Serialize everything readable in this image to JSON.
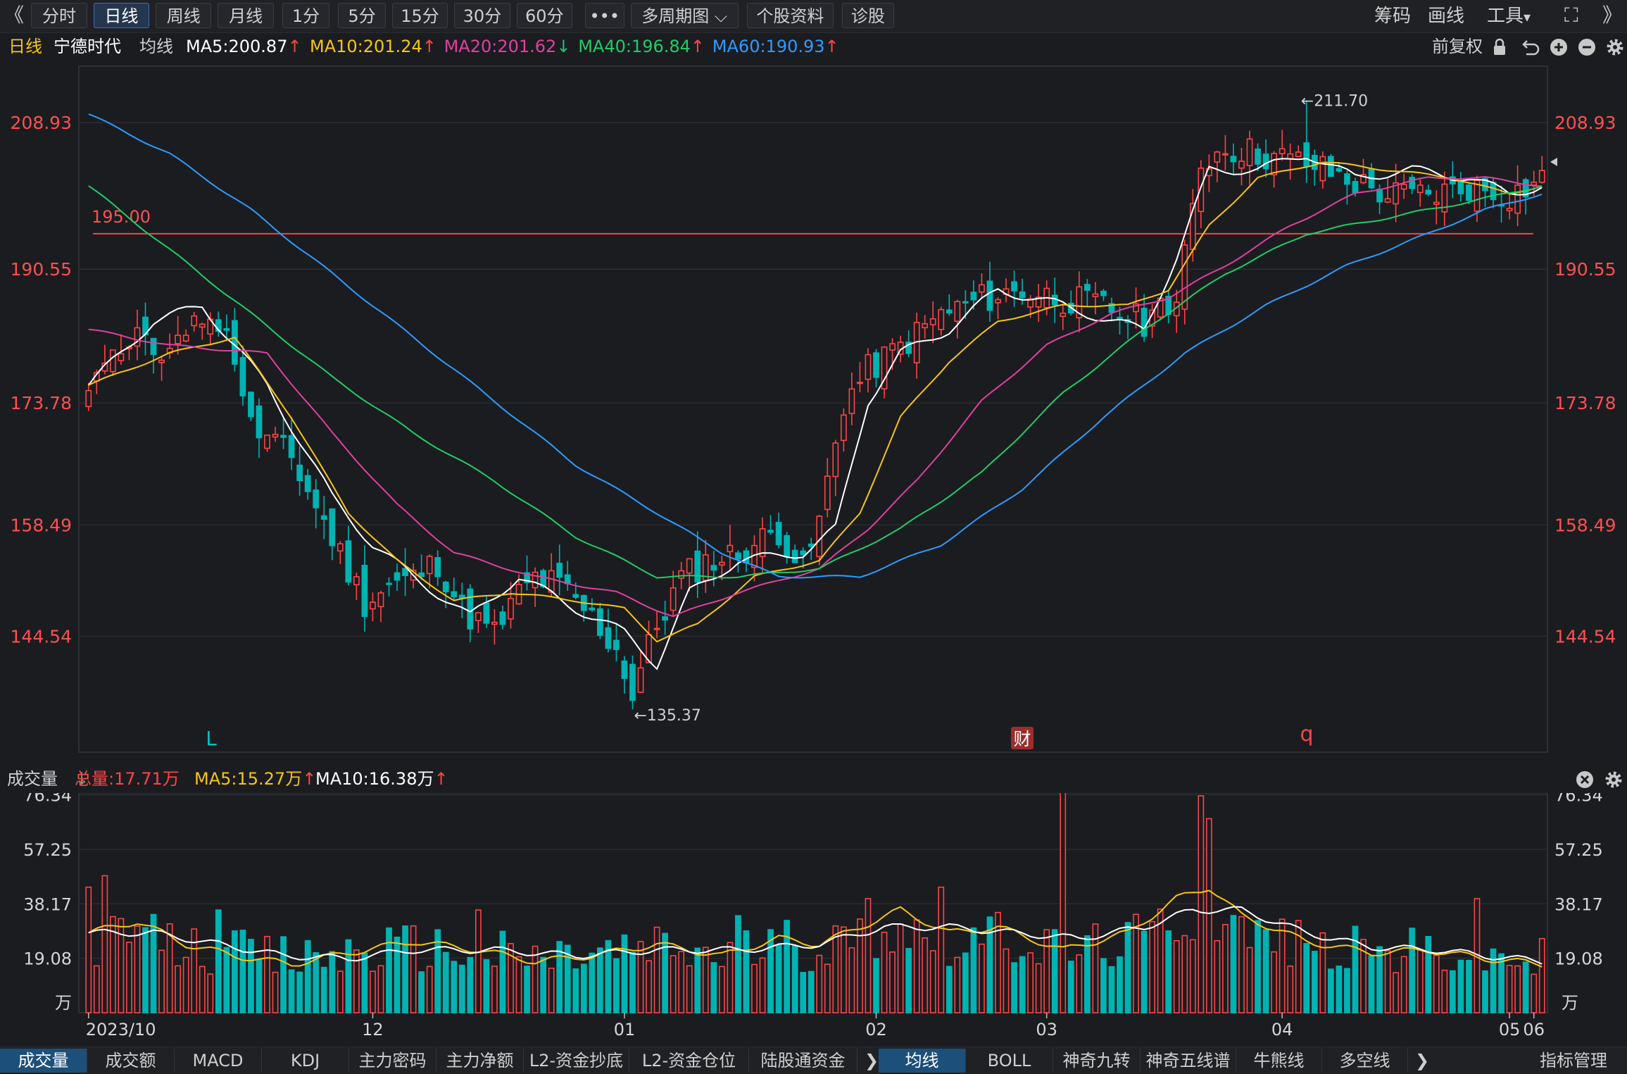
{
  "toolbar": {
    "back": "《",
    "buttons": [
      "分时",
      "日线",
      "周线",
      "月线",
      "1分",
      "5分",
      "15分",
      "30分",
      "60分",
      "•••",
      "多周期图 ⌵",
      "个股资料",
      "诊股"
    ],
    "right": [
      "筹码",
      "画线",
      "工具"
    ],
    "tool_caret": "▾",
    "expand": "⛶",
    "forward": "》"
  },
  "header": {
    "period": "日线",
    "stock_name": "宁德时代",
    "ma_label": "均线",
    "ma": [
      {
        "text": "MA5:200.87",
        "arrow": "↑",
        "color": "#ffffff"
      },
      {
        "text": "MA10:201.24",
        "arrow": "↑",
        "color": "#f5c518"
      },
      {
        "text": "MA20:201.62",
        "arrow": "↓",
        "color": "#e040a0"
      },
      {
        "text": "MA40:196.84",
        "arrow": "↑",
        "color": "#22cc66"
      },
      {
        "text": "MA60:190.93",
        "arrow": "↑",
        "color": "#2f9bff"
      }
    ],
    "adjust": "前复权",
    "icons": [
      "lock-icon",
      "undo-icon",
      "zoom-in-icon",
      "zoom-out-icon",
      "gear-icon"
    ]
  },
  "volume_header": {
    "label": "成交量",
    "total": "总量:17.71万",
    "total_arrow": "↓",
    "ma5": "MA5:15.27万",
    "ma5_arrow": "↑",
    "ma10": "MA10:16.38万",
    "ma10_arrow": "↑"
  },
  "colors": {
    "up": "#ff4444",
    "down": "#00b3b3",
    "grid": "#2e3036",
    "support_line": "#ff4040"
  },
  "chart_data": [
    {
      "type": "candlestick",
      "ylim": [
        130,
        216
      ],
      "y_ticks": [
        208.93,
        190.55,
        173.78,
        158.49,
        144.54
      ],
      "x_labels": [
        "2023/10",
        "12",
        "01",
        "02",
        "03",
        "04",
        "05",
        "06"
      ],
      "reference_line": {
        "value": 195.0,
        "label": "195.00"
      },
      "annotations": [
        {
          "text": "←211.70",
          "value": 211.7
        },
        {
          "text": "←135.37",
          "value": 135.37
        }
      ],
      "markers": [
        {
          "text": "L",
          "color": "#00c0c0"
        },
        {
          "text": "财",
          "color": "#ffffff",
          "bg": "#9b2d2d"
        },
        {
          "text": "q",
          "color": "#ff4444"
        }
      ],
      "series": [
        {
          "name": "MA5",
          "color": "#ffffff"
        },
        {
          "name": "MA10",
          "color": "#f5c518"
        },
        {
          "name": "MA20",
          "color": "#e040a0"
        },
        {
          "name": "MA40",
          "color": "#22cc66"
        },
        {
          "name": "MA60",
          "color": "#2f9bff"
        }
      ],
      "close_path": [
        [
          0,
          174
        ],
        [
          5,
          182
        ],
        [
          10,
          179
        ],
        [
          15,
          186
        ],
        [
          18,
          180
        ],
        [
          20,
          171
        ],
        [
          25,
          167
        ],
        [
          28,
          161
        ],
        [
          30,
          157
        ],
        [
          34,
          149
        ],
        [
          37,
          151
        ],
        [
          40,
          152
        ],
        [
          43,
          154
        ],
        [
          46,
          148
        ],
        [
          50,
          145
        ],
        [
          53,
          150
        ],
        [
          55,
          152
        ],
        [
          58,
          151
        ],
        [
          60,
          149
        ],
        [
          62,
          147
        ],
        [
          65,
          143
        ],
        [
          67,
          138
        ],
        [
          70,
          146
        ],
        [
          73,
          152
        ],
        [
          76,
          154
        ],
        [
          80,
          155
        ],
        [
          85,
          158
        ],
        [
          88,
          153
        ],
        [
          90,
          159
        ],
        [
          93,
          174
        ],
        [
          96,
          178
        ],
        [
          100,
          181
        ],
        [
          105,
          185
        ],
        [
          110,
          187
        ],
        [
          115,
          188
        ],
        [
          120,
          187
        ],
        [
          125,
          186
        ],
        [
          130,
          184
        ],
        [
          134,
          186
        ],
        [
          137,
          204
        ],
        [
          140,
          206
        ],
        [
          145,
          205
        ],
        [
          150,
          204
        ],
        [
          155,
          202
        ],
        [
          160,
          200
        ],
        [
          165,
          200
        ],
        [
          170,
          201
        ],
        [
          175,
          200
        ],
        [
          179,
          202
        ]
      ],
      "ma_paths": {
        "MA5": [
          [
            0,
            176
          ],
          [
            8,
            184
          ],
          [
            14,
            186
          ],
          [
            22,
            176
          ],
          [
            30,
            162
          ],
          [
            35,
            156
          ],
          [
            40,
            152
          ],
          [
            47,
            147
          ],
          [
            53,
            152
          ],
          [
            60,
            148
          ],
          [
            66,
            145
          ],
          [
            70,
            141
          ],
          [
            74,
            150
          ],
          [
            80,
            154
          ],
          [
            88,
            155
          ],
          [
            92,
            158
          ],
          [
            96,
            174
          ],
          [
            100,
            180
          ],
          [
            106,
            183
          ],
          [
            112,
            188
          ],
          [
            120,
            186
          ],
          [
            126,
            184
          ],
          [
            130,
            183
          ],
          [
            134,
            192
          ],
          [
            138,
            203
          ],
          [
            144,
            203
          ],
          [
            150,
            205
          ],
          [
            156,
            202
          ],
          [
            163,
            203
          ],
          [
            170,
            202
          ],
          [
            175,
            200
          ],
          [
            179,
            201
          ]
        ],
        "MA10": [
          [
            0,
            176
          ],
          [
            10,
            180
          ],
          [
            18,
            182
          ],
          [
            25,
            172
          ],
          [
            32,
            160
          ],
          [
            38,
            154
          ],
          [
            45,
            149
          ],
          [
            52,
            150
          ],
          [
            60,
            149
          ],
          [
            66,
            148
          ],
          [
            70,
            144
          ],
          [
            75,
            146
          ],
          [
            82,
            152
          ],
          [
            90,
            154
          ],
          [
            95,
            160
          ],
          [
            100,
            172
          ],
          [
            106,
            179
          ],
          [
            112,
            184
          ],
          [
            120,
            186
          ],
          [
            128,
            186
          ],
          [
            133,
            188
          ],
          [
            138,
            196
          ],
          [
            144,
            202
          ],
          [
            152,
            204
          ],
          [
            160,
            203
          ],
          [
            168,
            202
          ],
          [
            175,
            200
          ],
          [
            179,
            201
          ]
        ],
        "MA20": [
          [
            0,
            183
          ],
          [
            10,
            181
          ],
          [
            22,
            180
          ],
          [
            30,
            170
          ],
          [
            38,
            161
          ],
          [
            45,
            155
          ],
          [
            55,
            152
          ],
          [
            65,
            150
          ],
          [
            72,
            147
          ],
          [
            80,
            150
          ],
          [
            90,
            153
          ],
          [
            96,
            158
          ],
          [
            102,
            164
          ],
          [
            110,
            174
          ],
          [
            118,
            181
          ],
          [
            126,
            185
          ],
          [
            133,
            187
          ],
          [
            140,
            191
          ],
          [
            148,
            196
          ],
          [
            156,
            200
          ],
          [
            165,
            202
          ],
          [
            172,
            202
          ],
          [
            179,
            201
          ]
        ],
        "MA40": [
          [
            0,
            201
          ],
          [
            10,
            193
          ],
          [
            20,
            185
          ],
          [
            30,
            177
          ],
          [
            40,
            170
          ],
          [
            50,
            164
          ],
          [
            60,
            157
          ],
          [
            70,
            152
          ],
          [
            80,
            152
          ],
          [
            90,
            153
          ],
          [
            100,
            158
          ],
          [
            110,
            165
          ],
          [
            120,
            175
          ],
          [
            130,
            183
          ],
          [
            140,
            190
          ],
          [
            150,
            195
          ],
          [
            160,
            197
          ],
          [
            170,
            199
          ],
          [
            179,
            201
          ]
        ],
        "MA60": [
          [
            0,
            210
          ],
          [
            10,
            205
          ],
          [
            20,
            198
          ],
          [
            30,
            190
          ],
          [
            40,
            182
          ],
          [
            50,
            174
          ],
          [
            60,
            166
          ],
          [
            70,
            160
          ],
          [
            78,
            155
          ],
          [
            85,
            152
          ],
          [
            95,
            152
          ],
          [
            105,
            156
          ],
          [
            115,
            163
          ],
          [
            125,
            172
          ],
          [
            135,
            180
          ],
          [
            145,
            186
          ],
          [
            155,
            191
          ],
          [
            165,
            195
          ],
          [
            172,
            198
          ],
          [
            179,
            200
          ]
        ]
      },
      "n_bars": 180
    },
    {
      "type": "bar",
      "title": "成交量",
      "unit": "万",
      "ylim": [
        0,
        77
      ],
      "y_ticks": [
        76.34,
        57.25,
        38.17,
        19.08
      ],
      "ma_paths": {
        "MA5": [
          [
            0,
            28
          ],
          [
            6,
            32
          ],
          [
            12,
            24
          ],
          [
            18,
            20
          ],
          [
            25,
            17
          ],
          [
            32,
            21
          ],
          [
            40,
            25
          ],
          [
            48,
            22
          ],
          [
            55,
            18
          ],
          [
            62,
            20
          ],
          [
            70,
            24
          ],
          [
            78,
            20
          ],
          [
            85,
            26
          ],
          [
            90,
            24
          ],
          [
            95,
            30
          ],
          [
            100,
            36
          ],
          [
            106,
            28
          ],
          [
            112,
            30
          ],
          [
            120,
            22
          ],
          [
            128,
            28
          ],
          [
            134,
            40
          ],
          [
            138,
            44
          ],
          [
            142,
            34
          ],
          [
            150,
            25
          ],
          [
            158,
            21
          ],
          [
            165,
            22
          ],
          [
            172,
            19
          ],
          [
            179,
            17
          ]
        ],
        "MA10": [
          [
            0,
            28
          ],
          [
            8,
            28
          ],
          [
            16,
            24
          ],
          [
            24,
            20
          ],
          [
            32,
            19
          ],
          [
            40,
            22
          ],
          [
            50,
            22
          ],
          [
            60,
            20
          ],
          [
            70,
            22
          ],
          [
            80,
            22
          ],
          [
            90,
            24
          ],
          [
            98,
            30
          ],
          [
            106,
            30
          ],
          [
            114,
            28
          ],
          [
            122,
            26
          ],
          [
            130,
            30
          ],
          [
            136,
            36
          ],
          [
            142,
            36
          ],
          [
            150,
            28
          ],
          [
            158,
            23
          ],
          [
            166,
            22
          ],
          [
            172,
            20
          ],
          [
            179,
            18
          ]
        ]
      }
    }
  ],
  "tabs_left": [
    "成交量",
    "成交额",
    "MACD",
    "KDJ",
    "主力密码",
    "主力净额",
    "L2-资金抄底",
    "L2-资金仓位",
    "陆股通资金"
  ],
  "tabs_right": [
    "均线",
    "BOLL",
    "神奇九转",
    "神奇五线谱",
    "牛熊线",
    "多空线"
  ],
  "tab_arrow": "❯",
  "indicator_manage": "指标管理"
}
